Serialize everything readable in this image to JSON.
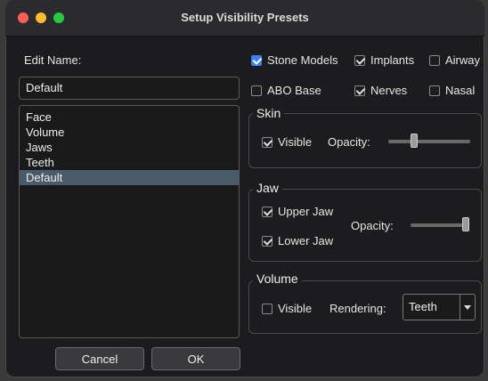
{
  "window": {
    "title": "Setup Visibility Presets"
  },
  "left": {
    "edit_name_label": "Edit Name:",
    "name_value": "Default",
    "presets": [
      "Face",
      "Volume",
      "Jaws",
      "Teeth",
      "Default"
    ],
    "selected_preset": "Default"
  },
  "options": {
    "stone_models": {
      "label": "Stone Models",
      "checked": true
    },
    "implants": {
      "label": "Implants",
      "checked": true
    },
    "airway": {
      "label": "Airway",
      "checked": false
    },
    "abo_base": {
      "label": "ABO Base",
      "checked": false
    },
    "nerves": {
      "label": "Nerves",
      "checked": true
    },
    "nasal": {
      "label": "Nasal",
      "checked": false
    }
  },
  "skin": {
    "title": "Skin",
    "visible_label": "Visible",
    "visible_checked": true,
    "opacity_label": "Opacity:",
    "opacity_value": 0.3
  },
  "jaw": {
    "title": "Jaw",
    "upper_label": "Upper Jaw",
    "upper_checked": true,
    "lower_label": "Lower Jaw",
    "lower_checked": true,
    "opacity_label": "Opacity:",
    "opacity_value": 1.0
  },
  "volume": {
    "title": "Volume",
    "visible_label": "Visible",
    "visible_checked": false,
    "rendering_label": "Rendering:",
    "rendering_value": "Teeth"
  },
  "buttons": {
    "cancel": "Cancel",
    "ok": "OK"
  },
  "colors": {
    "accent": "#3b82f6",
    "selection": "#4a5a68",
    "window_bg": "#1c1c1e"
  }
}
